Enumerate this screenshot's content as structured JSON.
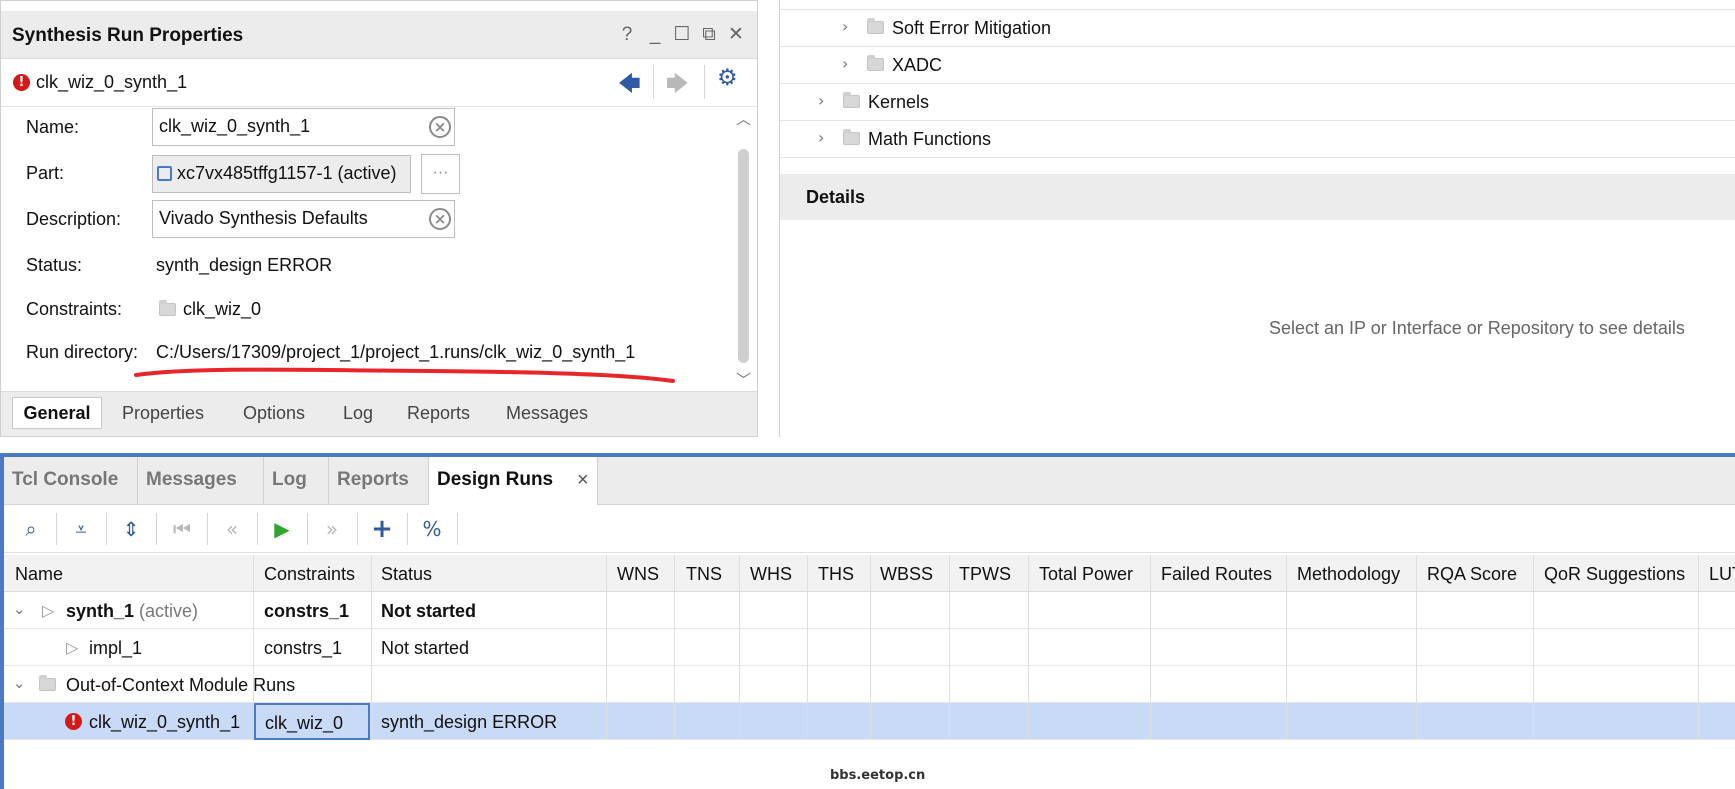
{
  "props_panel": {
    "title": "Synthesis Run Properties",
    "run_name": "clk_wiz_0_synth_1",
    "fields": {
      "name_label": "Name:",
      "name_value": "clk_wiz_0_synth_1",
      "part_label": "Part:",
      "part_value": "xc7vx485tffg1157-1 (active)",
      "part_browse": "···",
      "description_label": "Description:",
      "description_value": "Vivado Synthesis Defaults",
      "status_label": "Status:",
      "status_value": "synth_design ERROR",
      "constraints_label": "Constraints:",
      "constraints_value": "clk_wiz_0",
      "rundir_label": "Run directory:",
      "rundir_value": "C:/Users/17309/project_1/project_1.runs/clk_wiz_0_synth_1"
    },
    "tabs": [
      "General",
      "Properties",
      "Options",
      "Log",
      "Reports",
      "Messages"
    ],
    "active_tab": "General"
  },
  "ip_catalog": {
    "tree": [
      {
        "label": "Soft Error Mitigation",
        "level": 2
      },
      {
        "label": "XADC",
        "level": 2
      },
      {
        "label": "Kernels",
        "level": 1
      },
      {
        "label": "Math Functions",
        "level": 1
      }
    ],
    "details_title": "Details",
    "details_message": "Select an IP or Interface or Repository to see details"
  },
  "bottom_panel": {
    "tabs": [
      "Tcl Console",
      "Messages",
      "Log",
      "Reports",
      "Design Runs"
    ],
    "active_tab": "Design Runs",
    "close_glyph": "×",
    "columns": [
      "Name",
      "Constraints",
      "Status",
      "WNS",
      "TNS",
      "WHS",
      "THS",
      "WBSS",
      "TPWS",
      "Total Power",
      "Failed Routes",
      "Methodology",
      "RQA Score",
      "QoR Suggestions",
      "LUT"
    ],
    "rows": [
      {
        "name": "synth_1",
        "suffix": "(active)",
        "constraints": "constrs_1",
        "status": "Not started"
      },
      {
        "name": "impl_1",
        "constraints": "constrs_1",
        "status": "Not started"
      },
      {
        "name": "Out-of-Context Module Runs"
      },
      {
        "name": "clk_wiz_0_synth_1",
        "constraints": "clk_wiz_0",
        "status": "synth_design ERROR"
      }
    ]
  },
  "watermark": "bbs.eetop.cn",
  "colors": {
    "accent": "#4a79c7",
    "error": "#d51818",
    "selected_row": "#c9daf6",
    "annotation": "#e8262a",
    "run_green": "#2fa52f"
  }
}
